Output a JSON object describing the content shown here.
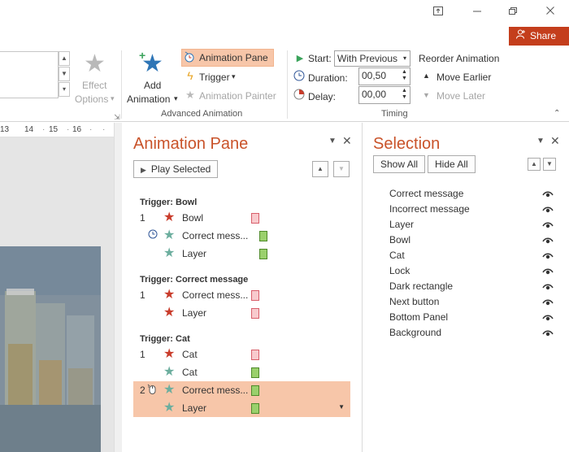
{
  "window": {
    "share_label": "Share"
  },
  "ribbon": {
    "effect_options": {
      "line1": "Effect",
      "line2": "Options",
      "caret": "▾"
    },
    "add_animation": {
      "line1": "Add",
      "line2": "Animation",
      "caret": "▾"
    },
    "animation_pane_label": "Animation Pane",
    "trigger_label": "Trigger",
    "trigger_caret": "▾",
    "animation_painter_label": "Animation Painter",
    "advanced_animation_label": "Advanced Animation",
    "start_label": "Start:",
    "start_value": "With Previous",
    "duration_label": "Duration:",
    "duration_value": "00,50",
    "delay_label": "Delay:",
    "delay_value": "00,00",
    "reorder_label": "Reorder Animation",
    "move_earlier_label": "Move Earlier",
    "move_later_label": "Move Later",
    "timing_label": "Timing"
  },
  "ruler": {
    "ticks": [
      "13",
      "14",
      "15",
      "16"
    ]
  },
  "animation_pane": {
    "title": "Animation Pane",
    "play_selected_label": "Play Selected",
    "groups": [
      {
        "trigger": "Trigger: Bowl",
        "rows": [
          {
            "num": "1",
            "label": "Bowl",
            "star": "red",
            "bar": "red"
          },
          {
            "num": "",
            "label": "Correct mess...",
            "star": "green",
            "bar": "green",
            "clock": true
          },
          {
            "num": "",
            "label": "Layer",
            "star": "green",
            "bar": "green"
          }
        ]
      },
      {
        "trigger": "Trigger: Correct message",
        "rows": [
          {
            "num": "1",
            "label": "Correct mess...",
            "star": "red",
            "bar": "red"
          },
          {
            "num": "",
            "label": "Layer",
            "star": "red",
            "bar": "red"
          }
        ]
      },
      {
        "trigger": "Trigger: Cat",
        "rows": [
          {
            "num": "1",
            "label": "Cat",
            "star": "red",
            "bar": "red"
          },
          {
            "num": "",
            "label": "Cat",
            "star": "green",
            "bar": "green"
          },
          {
            "num": "2",
            "label": "Correct mess...",
            "star": "green",
            "bar": "green",
            "selected": true
          },
          {
            "num": "",
            "label": "Layer",
            "star": "green",
            "bar": "green",
            "selected": true
          }
        ]
      }
    ]
  },
  "selection_pane": {
    "title": "Selection",
    "show_all_label": "Show All",
    "hide_all_label": "Hide All",
    "items": [
      "Correct message",
      "Incorrect message",
      "Layer",
      "Bowl",
      "Cat",
      "Lock",
      "Dark rectangle",
      "Next button",
      "Bottom Panel",
      "Background"
    ]
  },
  "colors": {
    "accent": "#c9532a",
    "share": "#c43e1c",
    "highlight": "#f7c6a9"
  }
}
